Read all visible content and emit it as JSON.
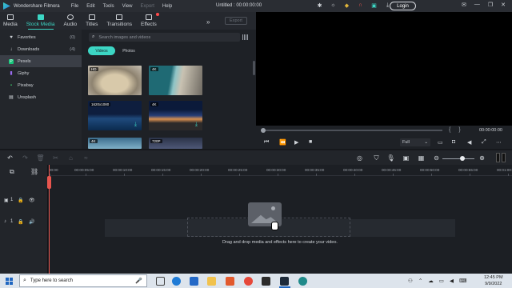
{
  "titlebar": {
    "app_name": "Wondershare Filmora",
    "menu": [
      "File",
      "Edit",
      "Tools",
      "View",
      "Export",
      "Help"
    ],
    "document_title": "Untitled : 00:00:00:00",
    "login_label": "Login"
  },
  "toolbar": {
    "tabs": [
      {
        "label": "Media",
        "icon": "media-icon"
      },
      {
        "label": "Stock Media",
        "icon": "stock-media-icon",
        "active": true
      },
      {
        "label": "Audio",
        "icon": "audio-icon"
      },
      {
        "label": "Titles",
        "icon": "titles-icon"
      },
      {
        "label": "Transitions",
        "icon": "transitions-icon"
      },
      {
        "label": "Effects",
        "icon": "effects-icon"
      }
    ],
    "export_label": "Export"
  },
  "sidebar": {
    "items": [
      {
        "label": "Favorites",
        "count": "(0)",
        "icon": "heart-icon"
      },
      {
        "label": "Downloads",
        "count": "(4)",
        "icon": "download-icon"
      },
      {
        "label": "Pexels",
        "count": "",
        "icon": "pexels-icon",
        "active": true
      },
      {
        "label": "Giphy",
        "count": "",
        "icon": "giphy-icon"
      },
      {
        "label": "Pixabay",
        "count": "",
        "icon": "pixabay-icon"
      },
      {
        "label": "Unsplash",
        "count": "",
        "icon": "unsplash-icon"
      }
    ]
  },
  "media": {
    "search_placeholder": "Search images and videos",
    "segments": [
      "Videos",
      "Photos"
    ],
    "active_segment": "Videos",
    "thumbnails": [
      {
        "badge": "HD"
      },
      {
        "badge": "4K"
      },
      {
        "badge": "1620x1080"
      },
      {
        "badge": "4K"
      },
      {
        "badge": "4K"
      },
      {
        "badge": "720P"
      }
    ]
  },
  "preview": {
    "time": "00:00:00:00",
    "quality": "Full"
  },
  "timeline": {
    "ruler": [
      "00:00",
      "00:00:05:00",
      "00:00:10:00",
      "00:00:15:00",
      "00:00:20:00",
      "00:00:25:00",
      "00:00:30:00",
      "00:00:35:00",
      "00:00:40:00",
      "00:00:45:00",
      "00:00:50:00",
      "00:00:55:00",
      "00:01:00:00"
    ],
    "video_track": "1",
    "audio_track": "1",
    "drop_hint": "Drag and drop media and effects here to create your video."
  },
  "taskbar": {
    "search_placeholder": "Type here to search",
    "time": "12:45 PM",
    "date": "9/9/2022"
  },
  "colors": {
    "accent": "#3cd6c4",
    "playhead": "#e8554e",
    "background": "#1c1f24"
  }
}
